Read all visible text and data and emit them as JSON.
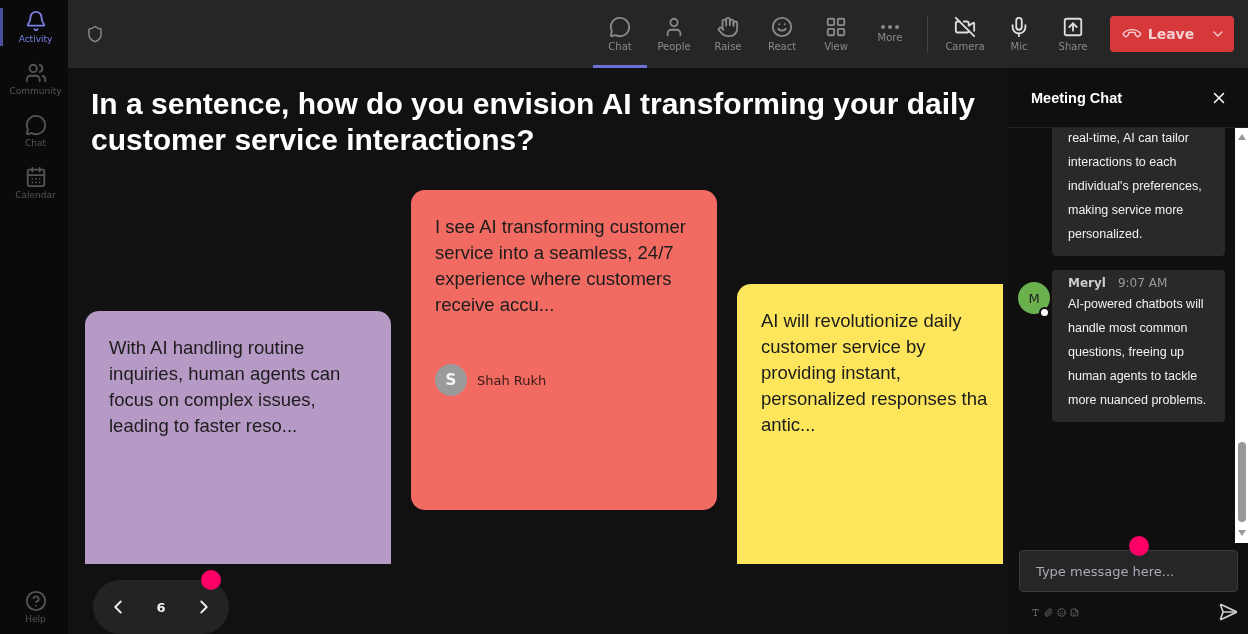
{
  "rail": {
    "items": [
      {
        "label": "Activity",
        "selected": true
      },
      {
        "label": "Community",
        "selected": false
      },
      {
        "label": "Chat",
        "selected": false
      },
      {
        "label": "Calendar",
        "selected": false
      }
    ],
    "help": {
      "label": "Help"
    }
  },
  "toolbar": {
    "items": [
      {
        "label": "Chat",
        "selected": true
      },
      {
        "label": "People",
        "selected": false
      },
      {
        "label": "Raise",
        "selected": false
      },
      {
        "label": "React",
        "selected": false
      },
      {
        "label": "View",
        "selected": false
      },
      {
        "label": "More",
        "selected": false
      }
    ],
    "devices": [
      {
        "label": "Camera"
      },
      {
        "label": "Mic"
      },
      {
        "label": "Share"
      }
    ],
    "leave": {
      "label": "Leave"
    }
  },
  "question": "In a sentence, how do you envision AI transforming your daily customer service interactions?",
  "cards": [
    {
      "text": "With AI handling routine inquiries, human agents can focus on complex issues, leading to faster reso...",
      "color": "#b799c6"
    },
    {
      "text": "I see AI transforming customer service into a seamless, 24/7 experience where customers receive accu...",
      "color": "#f26b62",
      "author": "Shah Rukh",
      "initial": "S"
    },
    {
      "text": "AI will revolutionize daily customer service by providing instant, personalized responses tha antic...",
      "color": "#fde65c"
    }
  ],
  "pager": {
    "page": "6"
  },
  "chat": {
    "title": "Meeting Chat",
    "messages": [
      {
        "text": "real-time, AI can tailor interactions to each individual's preferences, making service more personalized."
      },
      {
        "author": "Meryl",
        "initial": "M",
        "time": "9:07 AM",
        "text": "AI-powered chatbots will handle most common questions, freeing up human agents to tackle more nuanced problems."
      }
    ],
    "composer": {
      "placeholder": "Type message here..."
    }
  }
}
